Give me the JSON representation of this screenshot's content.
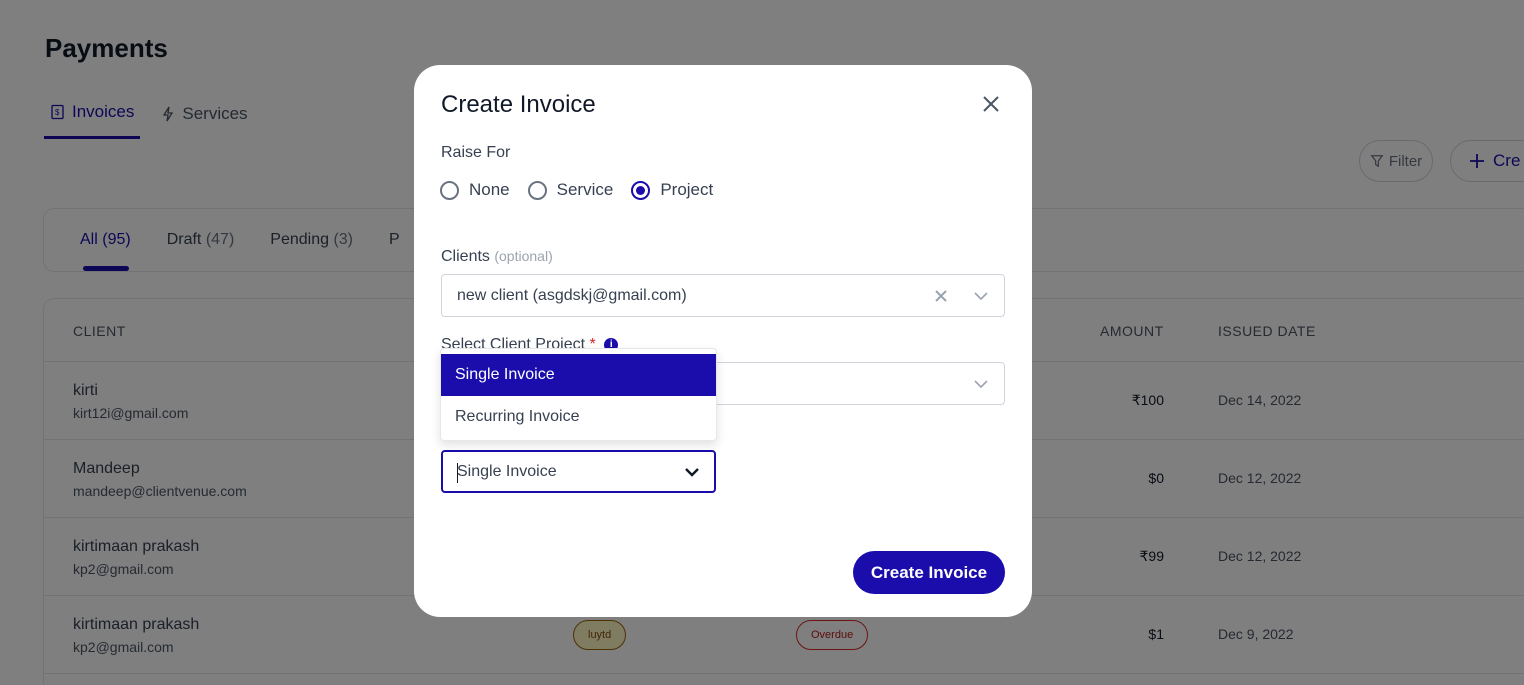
{
  "page": {
    "title": "Payments",
    "tabs": [
      {
        "label": "Invoices",
        "icon": "invoice-icon",
        "active": true
      },
      {
        "label": "Services",
        "icon": "sparkle-icon",
        "active": false
      }
    ],
    "filter_label": "Filter",
    "create_label": "Cre",
    "status_tabs": [
      {
        "label": "All",
        "count": "(95)",
        "active": true
      },
      {
        "label": "Draft",
        "count": "(47)",
        "active": false
      },
      {
        "label": "Pending",
        "count": "(3)",
        "active": false
      },
      {
        "label": "P",
        "count": "",
        "active": false
      }
    ],
    "table": {
      "headers": {
        "client": "CLIENT",
        "amount": "AMOUNT",
        "issued": "ISSUED DATE"
      },
      "rows": [
        {
          "name": "kirti",
          "email": "kirt12i@gmail.com",
          "amount": "₹100",
          "issued": "Dec 14, 2022"
        },
        {
          "name": "Mandeep",
          "email": "mandeep@clientvenue.com",
          "amount": "$0",
          "issued": "Dec 12, 2022"
        },
        {
          "name": "kirtimaan prakash",
          "email": "kp2@gmail.com",
          "amount": "₹99",
          "issued": "Dec 12, 2022"
        },
        {
          "name": "kirtimaan prakash",
          "email": "kp2@gmail.com",
          "amount": "$1",
          "issued": "Dec 9, 2022",
          "project_tag": "luytd",
          "status_tag": "Overdue"
        }
      ]
    }
  },
  "modal": {
    "title": "Create Invoice",
    "raise_for_label": "Raise For",
    "raise_for_options": [
      {
        "label": "None",
        "checked": false
      },
      {
        "label": "Service",
        "checked": false
      },
      {
        "label": "Project",
        "checked": true
      }
    ],
    "clients_label": "Clients",
    "clients_optional": "(optional)",
    "clients_value": "new client (asgdskj@gmail.com)",
    "project_label": "Select Client Project",
    "project_required": "*",
    "info_glyph": "i",
    "invoice_type_value": "Single Invoice",
    "dropdown_options": [
      {
        "label": "Single Invoice",
        "selected": true
      },
      {
        "label": "Recurring Invoice",
        "selected": false
      }
    ],
    "submit_label": "Create Invoice"
  },
  "colors": {
    "accent": "#1a0dab",
    "overlay": "rgba(0,0,0,0.5)"
  }
}
